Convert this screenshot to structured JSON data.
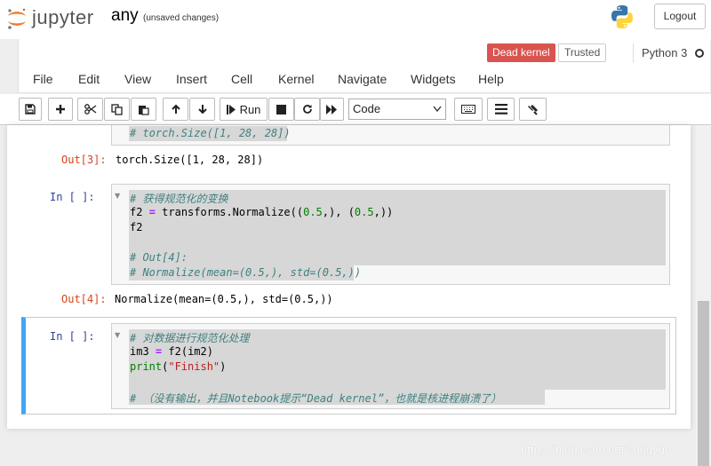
{
  "header": {
    "brand": "jupyter",
    "notebook_name": "any",
    "save_status": "(unsaved changes)",
    "logout_label": "Logout"
  },
  "status": {
    "kernel_state": "Dead kernel",
    "trusted_label": "Trusted",
    "kernel_name": "Python 3"
  },
  "menu": [
    "File",
    "Edit",
    "View",
    "Insert",
    "Cell",
    "Kernel",
    "Navigate",
    "Widgets",
    "Help"
  ],
  "toolbar": {
    "run_label": "Run",
    "cell_type": "Code",
    "icons": [
      "save-icon",
      "plus-icon",
      "cut-icon",
      "copy-icon",
      "paste-icon",
      "arrow-up-icon",
      "arrow-down-icon",
      "step-forward-icon",
      "stop-icon",
      "restart-icon",
      "fast-forward-icon",
      "keyboard-icon",
      "list-icon",
      "wrench-icon"
    ]
  },
  "cells": {
    "top_partial": {
      "line": "# torch.Size([1, 28, 28])"
    },
    "out3": {
      "prompt": "Out[3]:",
      "text": "torch.Size([1, 28, 28])"
    },
    "in4": {
      "prompt": "In  [  ]:",
      "comment1": "# 获得规范化的变换",
      "code_f2": "f2",
      "code_eq": "=",
      "code_call1": "transforms.Normalize((",
      "code_num1": "0.5",
      "code_mid": ",), (",
      "code_num2": "0.5",
      "code_end": ",))",
      "line2": "f2",
      "comment2": "# Out[4]:",
      "comment3": "# Normalize(mean=(0.5,), std=(0.5,))"
    },
    "out4": {
      "prompt": "Out[4]:",
      "text": "Normalize(mean=(0.5,), std=(0.5,))"
    },
    "in5": {
      "prompt": "In  [  ]:",
      "comment1": "# 对数据进行规范化处理",
      "code_im3": "im3",
      "code_eq": "=",
      "code_call": "f2(im2)",
      "code_print": "print",
      "code_paren1": "(",
      "code_str": "\"Finish\"",
      "code_paren2": ")",
      "comment2": "# （没有输出，并且Notebook提示“Dead kernel”，也就是核进程崩溃了）"
    }
  },
  "watermark": "https://blog.csdn.net/songyuc",
  "colors": {
    "dead_kernel": "#d9534f",
    "selected_cell_border": "#42a5f5",
    "out_prompt": "#d84315",
    "in_prompt": "#303f9f",
    "comment": "#408080"
  }
}
